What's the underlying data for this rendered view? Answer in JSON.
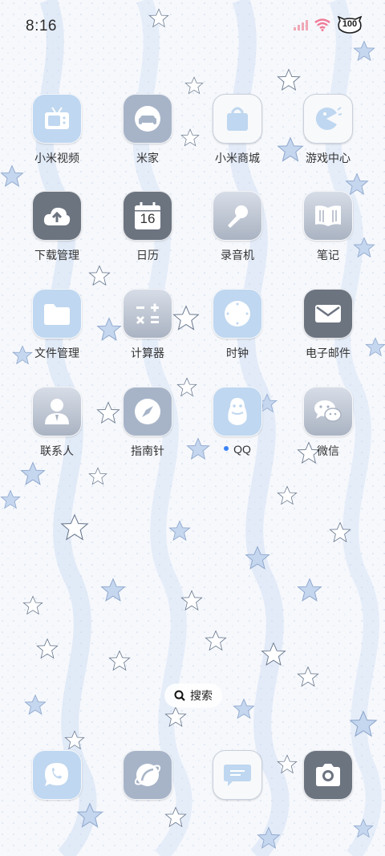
{
  "status_bar": {
    "time": "8:16",
    "battery": "100"
  },
  "apps": [
    {
      "label": "小米视频",
      "icon": "tv-icon"
    },
    {
      "label": "米家",
      "icon": "sofa-icon"
    },
    {
      "label": "小米商城",
      "icon": "shopping-bag-icon"
    },
    {
      "label": "游戏中心",
      "icon": "pacman-icon"
    },
    {
      "label": "下载管理",
      "icon": "cloud-upload-icon"
    },
    {
      "label": "日历",
      "icon": "calendar-icon",
      "date": "16"
    },
    {
      "label": "录音机",
      "icon": "microphone-icon"
    },
    {
      "label": "笔记",
      "icon": "book-icon"
    },
    {
      "label": "文件管理",
      "icon": "folder-icon"
    },
    {
      "label": "计算器",
      "icon": "calculator-icon"
    },
    {
      "label": "时钟",
      "icon": "clock-icon"
    },
    {
      "label": "电子邮件",
      "icon": "mail-icon"
    },
    {
      "label": "联系人",
      "icon": "contact-icon"
    },
    {
      "label": "指南针",
      "icon": "compass-icon"
    },
    {
      "label": "QQ",
      "icon": "penguin-icon"
    },
    {
      "label": "微信",
      "icon": "wechat-icon"
    }
  ],
  "search": {
    "label": "搜索"
  },
  "dock": [
    {
      "icon": "phone-icon"
    },
    {
      "icon": "browser-icon"
    },
    {
      "icon": "message-icon"
    },
    {
      "icon": "camera-icon"
    }
  ]
}
